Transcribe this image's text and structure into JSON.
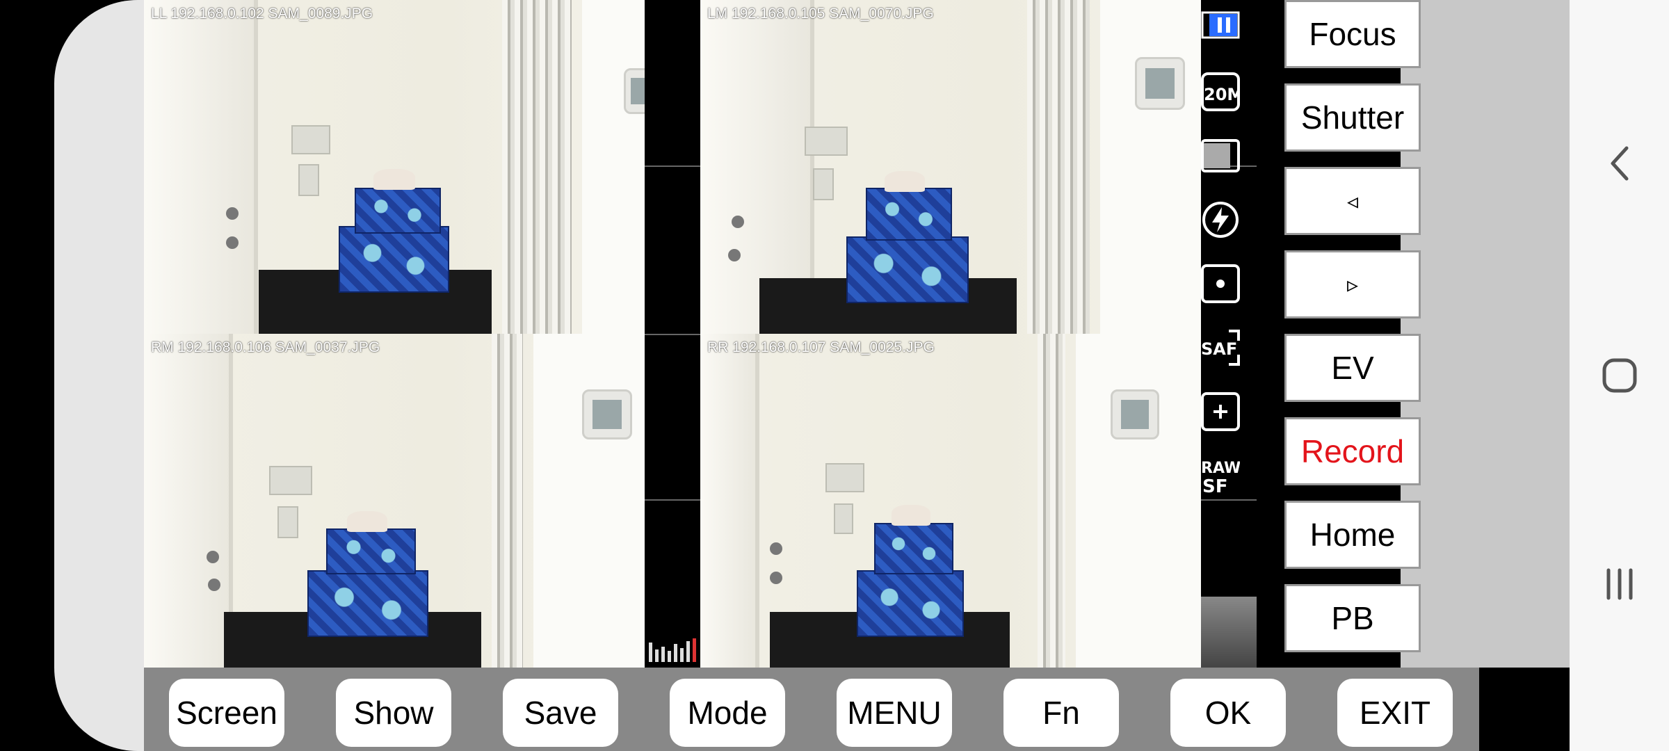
{
  "cameras": [
    {
      "id": "ll",
      "label": "LL 192.168.0.102 SAM_0089.JPG"
    },
    {
      "id": "lm",
      "label": "LM 192.168.0.105 SAM_0070.JPG"
    },
    {
      "id": "rm",
      "label": "RM 192.168.0.106 SAM_0037.JPG"
    },
    {
      "id": "rr",
      "label": "RR 192.168.0.107 SAM_0025.JPG"
    }
  ],
  "status_icons": [
    "pause-icon",
    "resolution-20m-icon",
    "aspect-ratio-icon",
    "flash-off-icon",
    "metering-spot-icon",
    "saf-focus-icon",
    "af-point-icon",
    "quality-sf-icon"
  ],
  "side_buttons": {
    "focus": "Focus",
    "shutter": "Shutter",
    "prev": "◃",
    "next": "▹",
    "ev": "EV",
    "record": "Record",
    "home": "Home",
    "pb": "PB"
  },
  "bottom_buttons": {
    "screen": "Screen",
    "show": "Show",
    "save": "Save",
    "mode": "Mode",
    "menu": "MENU",
    "fn": "Fn",
    "ok": "OK",
    "exit": "EXIT"
  },
  "colors": {
    "record": "#e3141b",
    "button_bg": "#ffffff",
    "bar_bg": "#888888",
    "panel_bg": "#c8c8c8"
  },
  "nav_icons": [
    "back-icon",
    "home-icon",
    "recents-icon"
  ]
}
